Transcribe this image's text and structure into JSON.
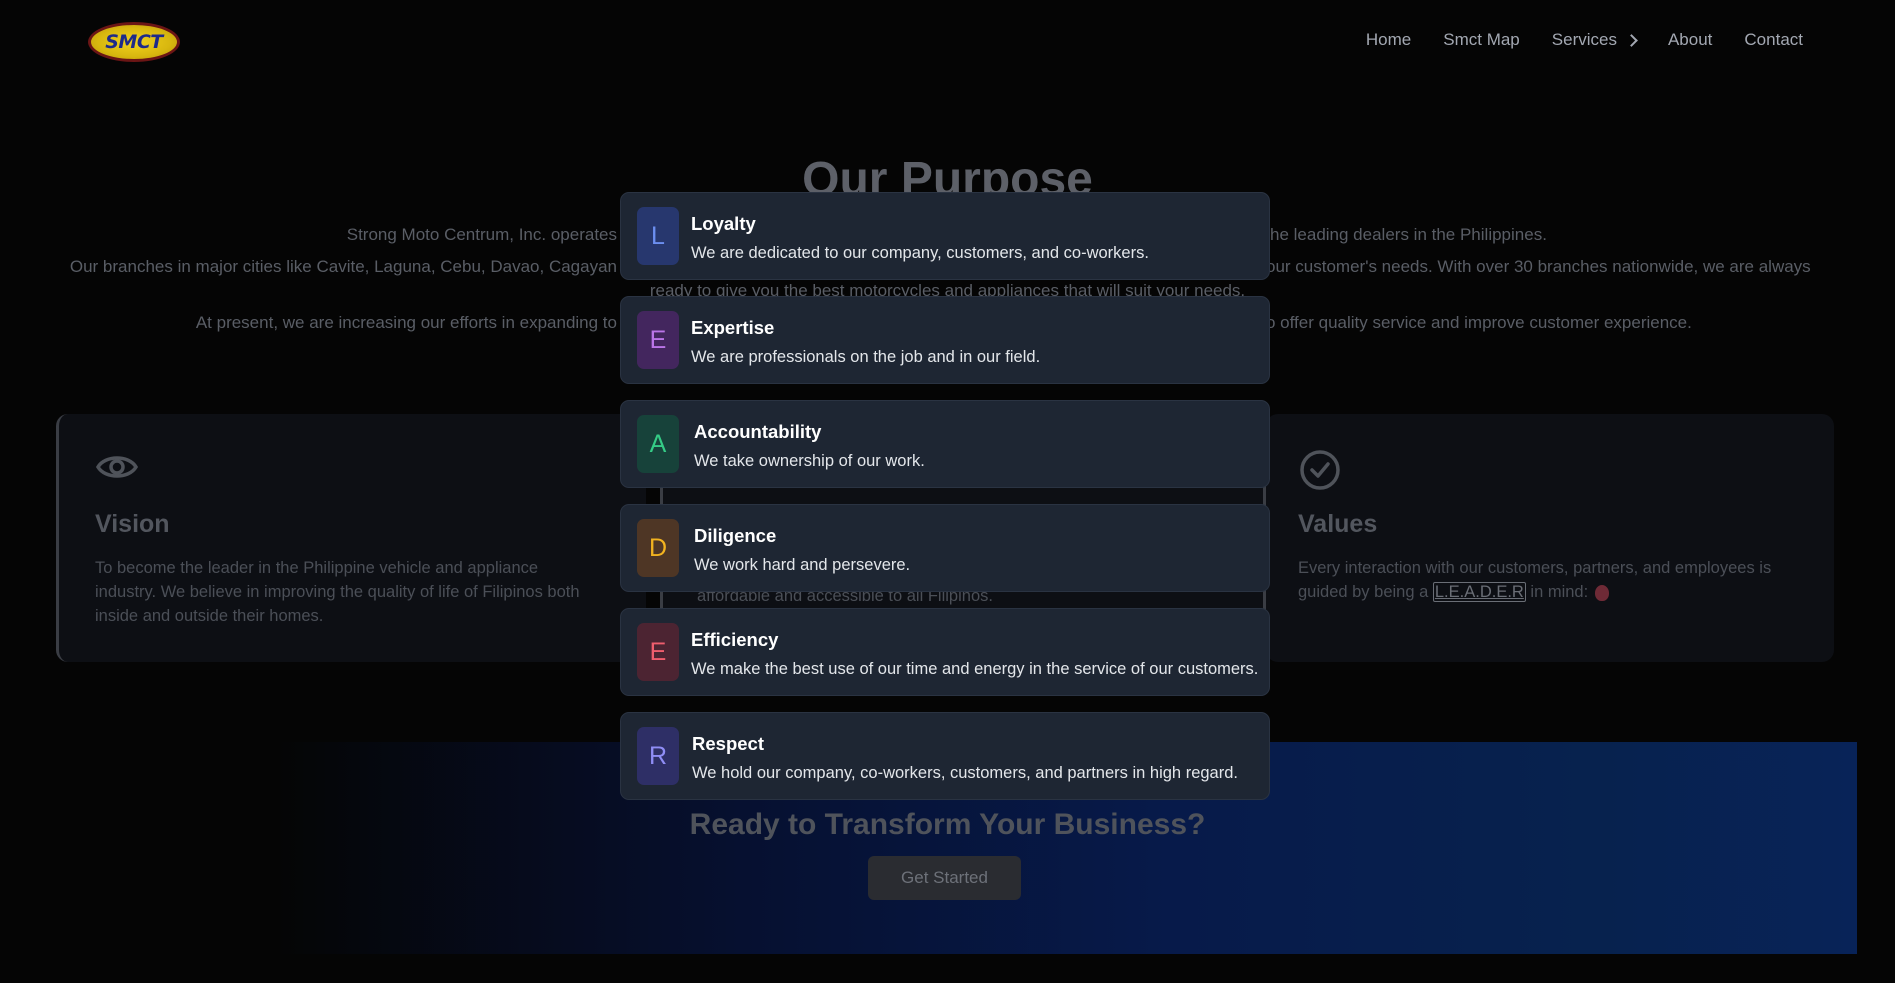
{
  "header": {
    "logo_text": "SMCT",
    "nav": [
      {
        "label": "Home"
      },
      {
        "label": "Smct Map"
      },
      {
        "label": "Services",
        "has_submenu": true
      },
      {
        "label": "About"
      },
      {
        "label": "Contact"
      }
    ]
  },
  "purpose": {
    "title": "Our Purpose",
    "line1_left": "Strong Moto Centrum, Inc. operates",
    "line1_right": "he leading dealers in the Philippines.",
    "line2_left": "Our branches in major cities like Cavite, Laguna, Cebu, Davao, Cagayan",
    "line2_right": "our customer's needs. With over 30 branches nationwide, we are always",
    "line3": "ready to give you the best motorcycles and appliances that will suit your needs.",
    "line4_left": "At present, we are increasing our efforts in expanding to",
    "line4_right": "o offer quality service and improve customer experience."
  },
  "vision": {
    "icon": "eye-icon",
    "title": "Vision",
    "text": "To become the leader in the Philippine vehicle and appliance industry. We believe in improving the quality of life of Filipinos both inside and outside their homes."
  },
  "mission": {
    "text": "affordable and accessible to all Filipinos."
  },
  "values": {
    "icon": "check-circle-icon",
    "title": "Values",
    "text_before": "Every interaction with our customers, partners, and employees is guided by being a",
    "leader_word": "L.E.A.D.E.R",
    "text_after": "in mind:"
  },
  "leader_values": [
    {
      "letter": "L",
      "title": "Loyalty",
      "desc": "We are dedicated to our company, customers, and co-workers.",
      "bg": "#27376e",
      "fg": "#6c8ff0"
    },
    {
      "letter": "E",
      "title": "Expertise",
      "desc": "We are professionals on the job and in our field.",
      "bg": "#43265e",
      "fg": "#bb75e8"
    },
    {
      "letter": "A",
      "title": "Accountability",
      "desc": "We take ownership of our work.",
      "bg": "#17423a",
      "fg": "#35cc86"
    },
    {
      "letter": "D",
      "title": "Diligence",
      "desc": "We work hard and persevere.",
      "bg": "#4e3625",
      "fg": "#f2b320"
    },
    {
      "letter": "E",
      "title": "Efficiency",
      "desc": "We make the best use of our time and energy in the service of our customers.",
      "bg": "#4c2432",
      "fg": "#ef5e6e"
    },
    {
      "letter": "R",
      "title": "Respect",
      "desc": "We hold our company, co-workers, customers, and partners in high regard.",
      "bg": "#2e2f66",
      "fg": "#8f8df5"
    }
  ],
  "cta": {
    "title": "Ready to Transform Your Business?",
    "button": "Get Started"
  }
}
